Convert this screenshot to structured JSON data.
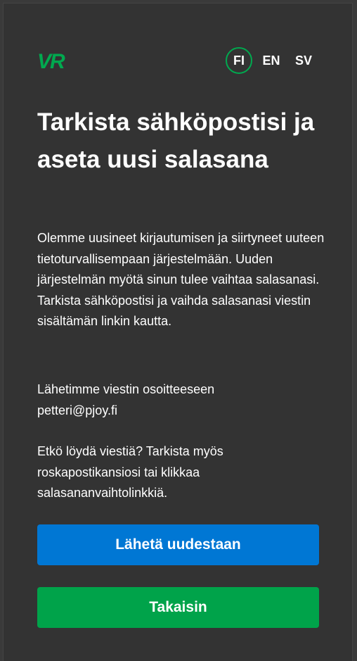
{
  "brand": {
    "logo_text": "VR",
    "accent_color": "#00a94f"
  },
  "languages": [
    {
      "code": "FI",
      "active": true
    },
    {
      "code": "EN",
      "active": false
    },
    {
      "code": "SV",
      "active": false
    }
  ],
  "title": "Tarkista sähköpostisi ja aseta uusi salasana",
  "paragraphs": {
    "intro": "Olemme uusineet kirjautumisen ja siirtyneet uuteen tietoturvallisempaan järjestelmään. Uuden järjestelmän myötä sinun tulee vaihtaa salasanasi. Tarkista sähköpostisi ja vaihda salasanasi viestin sisältämän linkin kautta.",
    "sent_to_label": "Lähetimme viestin osoitteeseen",
    "email": "petteri@pjoy.fi",
    "not_found": "Etkö löydä viestiä? Tarkista myös roskapostikansiosi tai klikkaa salasananvaihtolinkkiä."
  },
  "buttons": {
    "resend_label": "Lähetä uudestaan",
    "resend_color": "#0077d4",
    "back_label": "Takaisin",
    "back_color": "#00a34a"
  }
}
